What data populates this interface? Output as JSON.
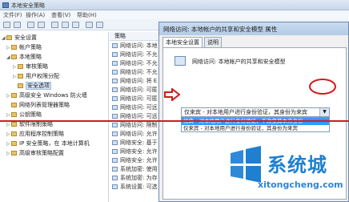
{
  "window": {
    "title": "本地安全策略"
  },
  "menu": [
    "文件(F)",
    "操作(A)",
    "查看(V)",
    "帮助(H)"
  ],
  "tree": {
    "items": [
      {
        "label": "安全设置",
        "expanded": true
      },
      {
        "label": "帐户策略"
      },
      {
        "label": "本地策略",
        "expanded": true
      },
      {
        "label": "审核策略"
      },
      {
        "label": "用户权限分配"
      },
      {
        "label": "安全选项",
        "selected": true
      },
      {
        "label": "高级安全 Windows 防火墙"
      },
      {
        "label": "网络列表管理器策略"
      },
      {
        "label": "公钥策略"
      },
      {
        "label": "软件限制策略"
      },
      {
        "label": "应用程序控制策略"
      },
      {
        "label": "IP 安全策略，在 本地计算机"
      },
      {
        "label": "高级审核策略配置"
      }
    ]
  },
  "list": {
    "header": "策略",
    "rows": [
      "网络访问: 本地",
      "网络访问: 不允",
      "网络访问: 不允",
      "网络访问: 不允",
      "网络访问: 将 E",
      "网络访问: 可匿",
      "网络访问: 可匿",
      "网络访问: 可远",
      "网络访问: 可远",
      "网络访问: 限制",
      "网络访问: 允许",
      "网络安全: 基于",
      "网络安全: 允许",
      "网络安全: 允许",
      "系统加密: 使用",
      "系统加密: 为存",
      "系统设置: 可选"
    ]
  },
  "dialog": {
    "title": "网络访问: 本地帐户的共享和安全模型 属性",
    "tabs": [
      "本地安全设置",
      "说明"
    ],
    "policy_name": "网络访问: 本地帐户的共享和安全模型",
    "selected_value": "仅来宾 - 对本地用户进行身份验证，其身份为来宾",
    "options": [
      "经典 - 对本地用户进行身份验证，不改变其本来身份",
      "仅来宾 - 对本地用户进行身份验证，其身份为来宾"
    ]
  },
  "watermark": {
    "brand": "系统城",
    "url": "xitongcheng.com"
  },
  "colors": {
    "annotation": "#d11a1a",
    "highlight": "#3399ff",
    "brand": "#1f7fd0"
  }
}
